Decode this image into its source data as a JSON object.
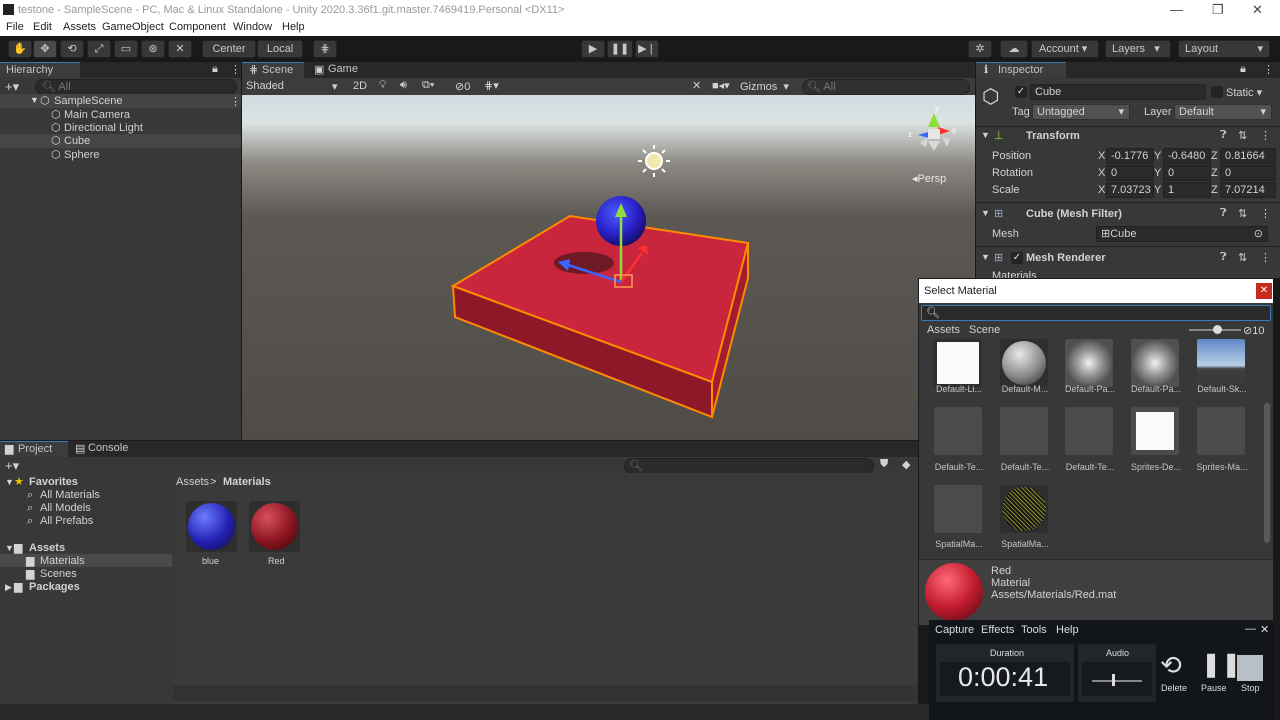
{
  "window": {
    "title": "testone - SampleScene - PC, Mac & Linux Standalone - Unity 2020.3.36f1.git.master.7469419.Personal <DX11>",
    "controls": [
      "—",
      "❐",
      "✕"
    ]
  },
  "menu": [
    "File",
    "Edit",
    "Assets",
    "GameObject",
    "Component",
    "Window",
    "Help"
  ],
  "toolbar": {
    "pivot": "Center",
    "space": "Local",
    "account": "Account",
    "layers": "Layers",
    "layout": "Layout"
  },
  "hierarchy": {
    "tab": "Hierarchy",
    "search_placeholder": "All",
    "scene": "SampleScene",
    "items": [
      "Main Camera",
      "Directional Light",
      "Cube",
      "Sphere"
    ],
    "selected": "Cube"
  },
  "scene_view": {
    "tabs": [
      "Scene",
      "Game"
    ],
    "shading": "Shaded",
    "mode_2d": "2D",
    "hidden_count": "0",
    "gizmos": "Gizmos",
    "search_placeholder": "All",
    "projection": "Persp",
    "colors": {
      "plane": "#c8213b",
      "sphere": "#2a20c8",
      "sky": "#d9e2e6",
      "ground": "#56524e"
    }
  },
  "inspector": {
    "tab": "Inspector",
    "object_name": "Cube",
    "static_label": "Static",
    "tag_label": "Tag",
    "tag_value": "Untagged",
    "layer_label": "Layer",
    "layer_value": "Default",
    "transform": {
      "title": "Transform",
      "rows": [
        {
          "label": "Position",
          "x": "-0.1776",
          "y": "-0.6480",
          "z": "0.81664"
        },
        {
          "label": "Rotation",
          "x": "0",
          "y": "0",
          "z": "0"
        },
        {
          "label": "Scale",
          "x": "7.03723",
          "y": "1",
          "z": "7.07214"
        }
      ]
    },
    "mesh_filter": {
      "title": "Cube (Mesh Filter)",
      "mesh_label": "Mesh",
      "mesh_value": "Cube"
    },
    "mesh_renderer": {
      "title": "Mesh Renderer",
      "materials_label": "Materials"
    }
  },
  "project": {
    "tabs": [
      "Project",
      "Console"
    ],
    "favorites_label": "Favorites",
    "favorites": [
      "All Materials",
      "All Models",
      "All Prefabs"
    ],
    "assets_label": "Assets",
    "asset_folders": [
      "Materials",
      "Scenes"
    ],
    "packages_label": "Packages",
    "breadcrumb": [
      "Assets",
      ">",
      "Materials"
    ],
    "materials": [
      {
        "name": "blue",
        "color": "#2320b0"
      },
      {
        "name": "Red",
        "color": "#8a1420"
      }
    ]
  },
  "select_material": {
    "title": "Select Material",
    "tabs": [
      "Assets",
      "Scene"
    ],
    "hidden_count": "10",
    "items": [
      "Default-Li...",
      "Default-M...",
      "Default-Pa...",
      "Default-Pa...",
      "Default-Sk...",
      "Default-Te...",
      "Default-Te...",
      "Default-Te...",
      "Sprites-De...",
      "Sprites-Ma...",
      "SpatialMa...",
      "SpatialMa..."
    ],
    "preview": {
      "name": "Red",
      "type": "Material",
      "path": "Assets/Materials/Red.mat",
      "color": "#c21c2e"
    }
  },
  "recorder": {
    "menu": [
      "Capture",
      "Effects",
      "Tools",
      "Help"
    ],
    "duration_label": "Duration",
    "duration": "0:00:41",
    "audio_label": "Audio",
    "buttons": [
      "Delete",
      "Pause",
      "Stop"
    ]
  }
}
